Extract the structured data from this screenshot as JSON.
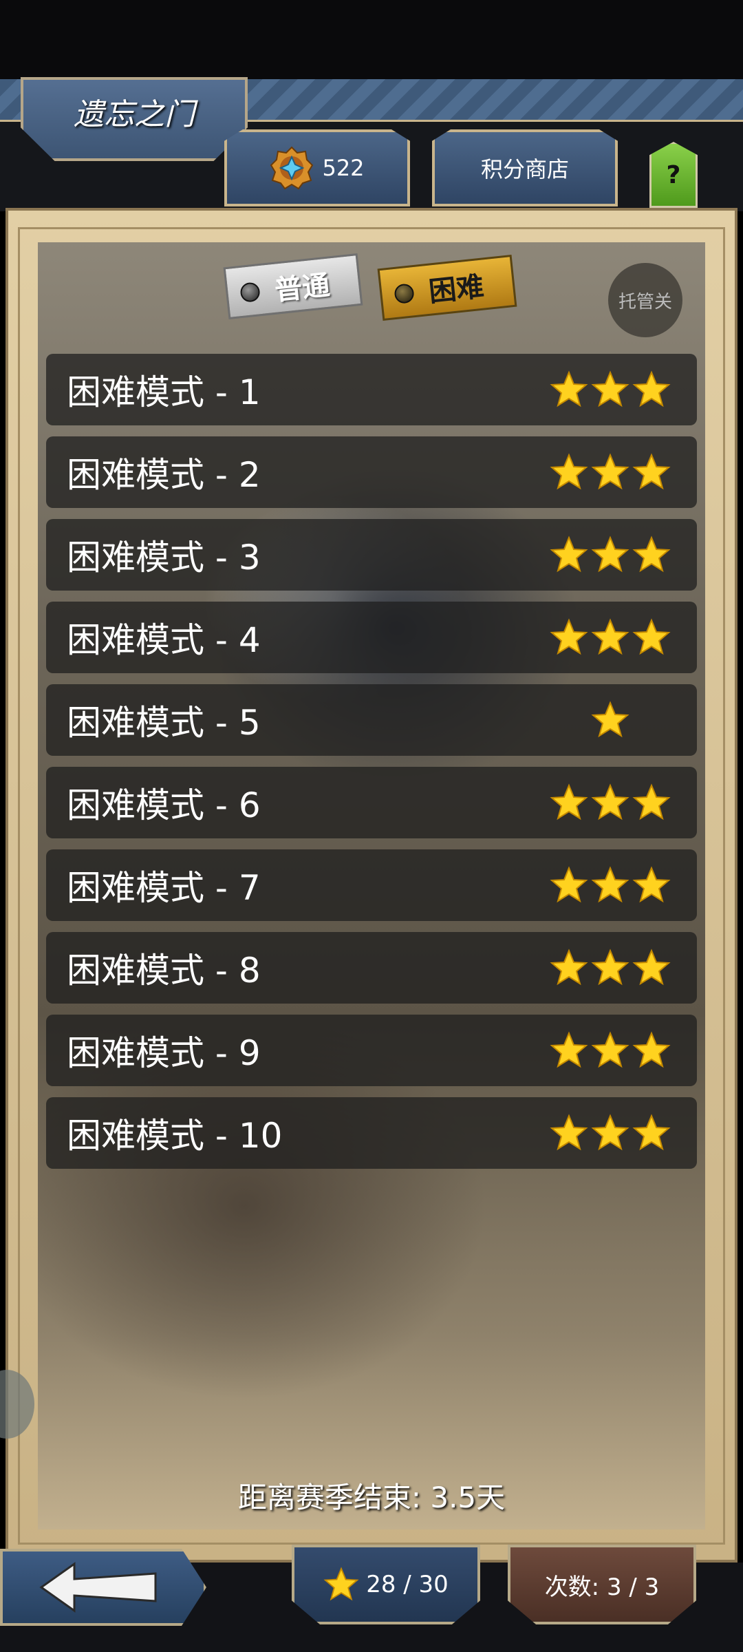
{
  "header": {
    "title": "遗忘之门",
    "points_value": "522",
    "shop_label": "积分商店",
    "help_label": "?"
  },
  "modes": {
    "normal_label": "普通",
    "hard_label": "困难",
    "auto_label": "托管关"
  },
  "levels": [
    {
      "label": "困难模式 - 1",
      "stars": 3
    },
    {
      "label": "困难模式 - 2",
      "stars": 3
    },
    {
      "label": "困难模式 - 3",
      "stars": 3
    },
    {
      "label": "困难模式 - 4",
      "stars": 3
    },
    {
      "label": "困难模式 - 5",
      "stars": 1
    },
    {
      "label": "困难模式 - 6",
      "stars": 3
    },
    {
      "label": "困难模式 - 7",
      "stars": 3
    },
    {
      "label": "困难模式 - 8",
      "stars": 3
    },
    {
      "label": "困难模式 - 9",
      "stars": 3
    },
    {
      "label": "困难模式 - 10",
      "stars": 3
    }
  ],
  "season": {
    "text": "距离赛季结束: 3.5天"
  },
  "footer": {
    "stars_total": "28 / 30",
    "attempts": "次数: 3 / 3"
  },
  "icons": {
    "gem": "gem-icon",
    "star": "star-icon",
    "back": "back-arrow-icon"
  },
  "colors": {
    "star": "#FFD21F",
    "hard_tab": "#D9A02A",
    "help_button": "#7BC23D"
  }
}
